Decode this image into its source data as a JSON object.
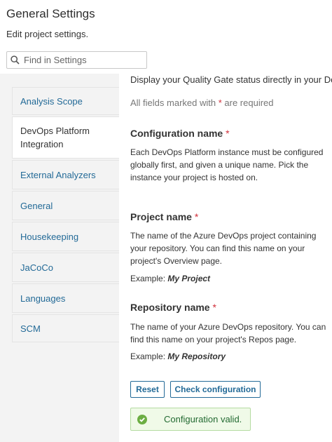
{
  "header": {
    "title": "General Settings",
    "subtitle": "Edit project settings."
  },
  "search": {
    "placeholder": "Find in Settings"
  },
  "sidebar": {
    "items": [
      {
        "label": "Analysis Scope"
      },
      {
        "label": "DevOps Platform Integration"
      },
      {
        "label": "External Analyzers"
      },
      {
        "label": "General"
      },
      {
        "label": "Housekeeping"
      },
      {
        "label": "JaCoCo"
      },
      {
        "label": "Languages"
      },
      {
        "label": "SCM"
      }
    ]
  },
  "main": {
    "intro": "Display your Quality Gate status directly in your DevOps",
    "required_note": {
      "before": "All fields marked with ",
      "star": "*",
      "after": " are required"
    },
    "config_name": {
      "title": "Configuration name",
      "star": "*",
      "text": "Each DevOps Platform instance must be configured globally first, and given a unique name. Pick the instance your project is hosted on."
    },
    "project_name": {
      "title": "Project name",
      "star": "*",
      "text": "The name of the Azure DevOps project containing your repository. You can find this name on your project's Overview page.",
      "example_label": "Example: ",
      "example_value": "My Project"
    },
    "repository_name": {
      "title": "Repository name",
      "star": "*",
      "text": "The name of your Azure DevOps repository. You can find this name on your project's Repos page.",
      "example_label": "Example: ",
      "example_value": "My Repository"
    },
    "buttons": {
      "reset": "Reset",
      "check": "Check configuration"
    },
    "status": {
      "message": "Configuration valid.",
      "icon": "check-circle-icon",
      "color": "#6cae43"
    }
  },
  "colors": {
    "link": "#236a97",
    "required": "#d02f3a"
  }
}
